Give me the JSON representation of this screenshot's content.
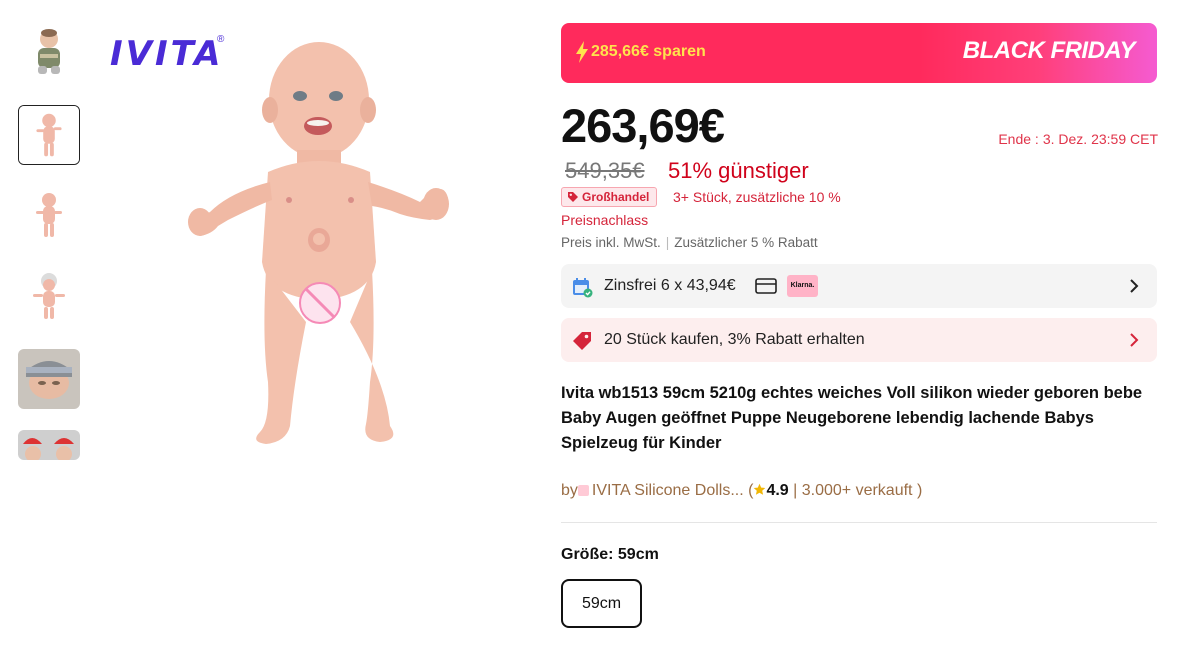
{
  "brand_logo": "IVITA",
  "brand_mark": "®",
  "thumbnails": [
    {
      "label": "thumb-1"
    },
    {
      "label": "thumb-2"
    },
    {
      "label": "thumb-3"
    },
    {
      "label": "thumb-4"
    },
    {
      "label": "thumb-5"
    },
    {
      "label": "thumb-6"
    }
  ],
  "promo": {
    "save_text": "285,66€ sparen",
    "event": "BLACK FRIDAY"
  },
  "price": {
    "current": "263,69€",
    "original": "549,35€",
    "discount": "51% günstiger",
    "end_label": "Ende :",
    "end_time": "3. Dez. 23:59 CET"
  },
  "bulk": {
    "badge": "Großhandel",
    "text": "3+ Stück, zusätzliche 10 %",
    "sub": "Preisnachlass"
  },
  "tax": {
    "left": "Preis inkl. MwSt.",
    "right": "Zusätzlicher 5 % Rabatt"
  },
  "installment": {
    "text": "Zinsfrei 6 x 43,94€",
    "klarna_label": "Klarna."
  },
  "bulk_offer": {
    "text": "20 Stück kaufen, 3% Rabatt erhalten"
  },
  "product_title": "Ivita wb1513 59cm 5210g echtes weiches Voll silikon wieder geboren bebe Baby Augen geöffnet Puppe Neugeborene lebendig lachende Babys Spielzeug für Kinder",
  "seller": {
    "by": "by",
    "store": "IVITA Silicone Dolls...",
    "open": " (",
    "rating": "4.9",
    "sold": " | 3.000+ verkauft )"
  },
  "size": {
    "label": "Größe: 59cm",
    "option": "59cm"
  },
  "colors": {
    "accent_red": "#d5243a",
    "promo_pink": "#ff2a5c",
    "promo_yellow": "#ffe34d",
    "logo_purple": "#4a2bd6"
  }
}
